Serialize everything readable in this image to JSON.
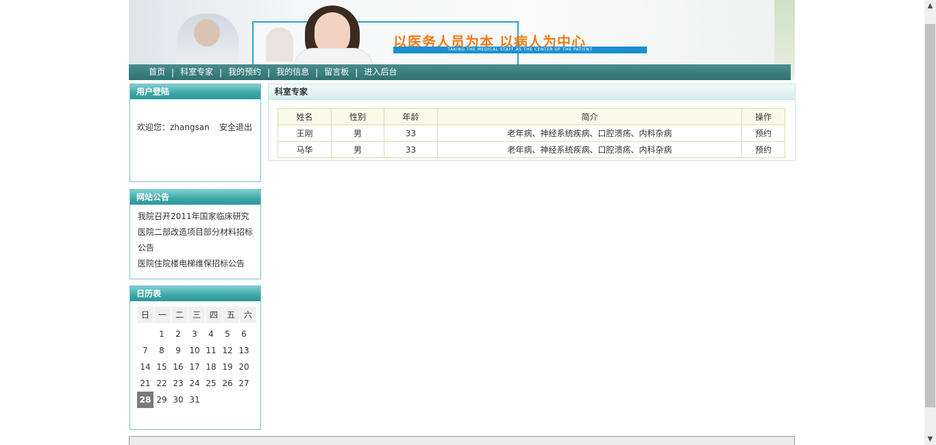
{
  "banner": {
    "slogan": "以医务人员为本 以病人为中心",
    "slogan_en": "TAKING THE MEDICAL STAFF AS THE CENTER OF THE PATIENT"
  },
  "nav": {
    "items": [
      {
        "label": "首页"
      },
      {
        "label": "科室专家"
      },
      {
        "label": "我的预约"
      },
      {
        "label": "我的信息"
      },
      {
        "label": "留言板"
      },
      {
        "label": "进入后台"
      }
    ],
    "separator": "|"
  },
  "login": {
    "title": "用户登陆",
    "welcome": "欢迎您：zhangsan",
    "logout": "安全退出"
  },
  "notice": {
    "title": "网站公告",
    "items": [
      {
        "text": "我院召开2011年国家临床研究"
      },
      {
        "text": "医院二部改造项目部分材料招标公告"
      },
      {
        "text": "医院住院楼电梯维保招标公告"
      }
    ]
  },
  "calendar": {
    "title": "日历表",
    "weekdays": [
      "日",
      "一",
      "二",
      "三",
      "四",
      "五",
      "六"
    ],
    "weeks": [
      [
        "",
        "1",
        "2",
        "3",
        "4",
        "5",
        "6"
      ],
      [
        "7",
        "8",
        "9",
        "10",
        "11",
        "12",
        "13"
      ],
      [
        "14",
        "15",
        "16",
        "17",
        "18",
        "19",
        "20"
      ],
      [
        "21",
        "22",
        "23",
        "24",
        "25",
        "26",
        "27"
      ],
      [
        "28",
        "29",
        "30",
        "31",
        "",
        "",
        ""
      ]
    ],
    "today": "28"
  },
  "main": {
    "title": "科室专家",
    "columns": [
      "姓名",
      "性别",
      "年龄",
      "简介",
      "操作"
    ],
    "rows": [
      {
        "name": "王刚",
        "gender": "男",
        "age": "33",
        "intro": "老年病、神经系统疾病、口腔溃疡、内科杂病",
        "action": "预约"
      },
      {
        "name": "马华",
        "gender": "男",
        "age": "33",
        "intro": "老年病、神经系统疾病、口腔溃疡、内科杂病",
        "action": "预约"
      }
    ]
  },
  "scrollbar": {
    "up_arrow_icon": "chevron-up-icon",
    "down_arrow_icon": "chevron-down-icon"
  }
}
